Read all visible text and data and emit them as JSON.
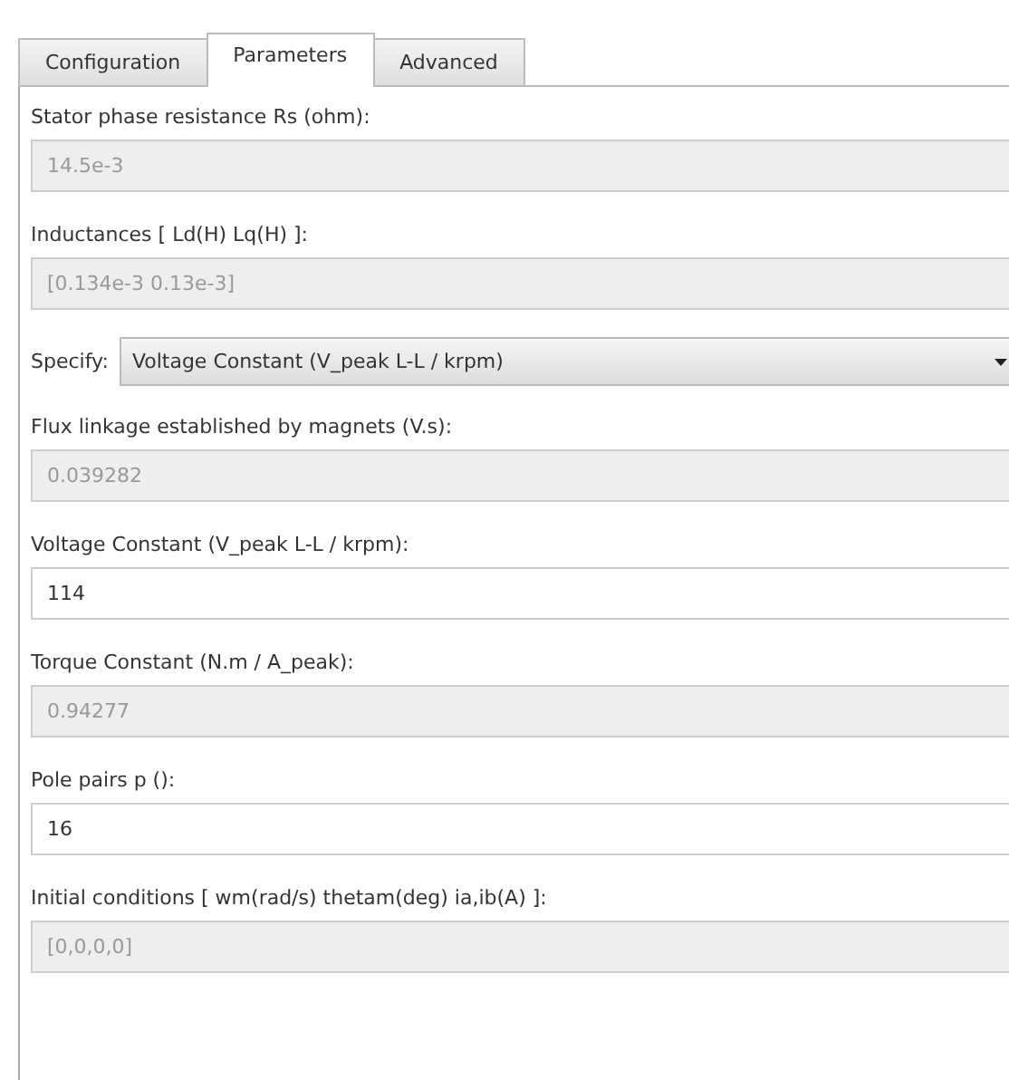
{
  "tabs": [
    {
      "label": "Configuration",
      "selected": false
    },
    {
      "label": "Parameters",
      "selected": true
    },
    {
      "label": "Advanced",
      "selected": false
    }
  ],
  "params": [
    {
      "kind": "field",
      "label": "Stator phase resistance Rs (ohm):",
      "value": "14.5e-3",
      "disabled": true
    },
    {
      "kind": "field",
      "label": "Inductances [ Ld(H) Lq(H) ]:",
      "value": "[0.134e-3 0.13e-3]",
      "disabled": true
    },
    {
      "kind": "select",
      "label": "Specify:",
      "value": "Voltage Constant (V_peak L-L / krpm)",
      "disabled": false
    },
    {
      "kind": "field",
      "label": "Flux linkage established by magnets (V.s):",
      "value": "0.039282",
      "disabled": true
    },
    {
      "kind": "field",
      "label": "Voltage Constant (V_peak L-L / krpm):",
      "value": "114",
      "disabled": false
    },
    {
      "kind": "field",
      "label": "Torque Constant (N.m / A_peak):",
      "value": "0.94277",
      "disabled": true
    },
    {
      "kind": "field",
      "label": "Pole pairs p ():",
      "value": "16",
      "disabled": false
    },
    {
      "kind": "field",
      "label": "Initial conditions  [ wm(rad/s)  thetam(deg)  ia,ib(A) ]:",
      "value": "[0,0,0,0]",
      "disabled": true
    }
  ]
}
